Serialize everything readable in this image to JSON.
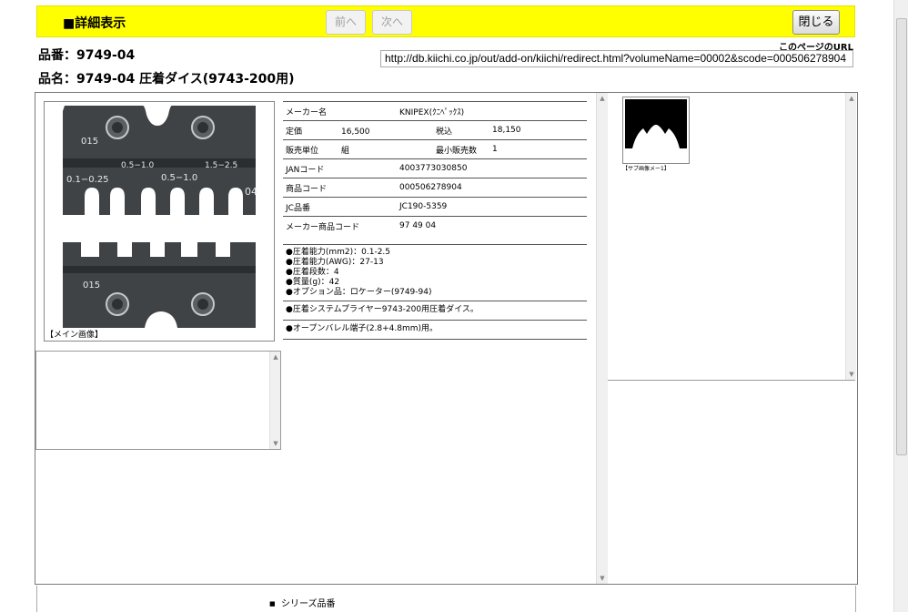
{
  "header": {
    "title": "■詳細表示",
    "prev_label": "前へ",
    "next_label": "次へ",
    "close_label": "閉じる"
  },
  "page_url": {
    "label": "このページのURL",
    "value": "http://db.kiichi.co.jp/out/add-on/kiichi/redirect.html?volumeName=00002&scode=000506278904"
  },
  "product": {
    "number_line": "品番：9749-04",
    "name_line": "品名：9749-04 圧着ダイス(9743-200用)"
  },
  "main_image": {
    "caption": "【メイン画像】",
    "die_labels": {
      "top_code": "015",
      "bottom_code": "015",
      "size_a": "0.5−1.0",
      "size_b": "1.5−2.5",
      "size_c": "0.1−0.25",
      "size_d": "0.5−1.0",
      "part_no": "04"
    }
  },
  "info": {
    "maker_label": "メーカー名",
    "maker_value": "KNIPEX(ｸﾆﾍﾟｯｸｽ)",
    "price_label": "定価",
    "price_value": "16,500",
    "tax_label": "税込",
    "tax_value": "18,150",
    "unit_label": "販売単位",
    "unit_value": "組",
    "min_label": "最小販売数",
    "min_value": "1",
    "jan_label": "JANコード",
    "jan_value": "4003773030850",
    "code_label": "商品コード",
    "code_value": "000506278904",
    "jc_label": "JC品番",
    "jc_value": "JC190-5359",
    "maker_code_label": "メーカー商品コード",
    "maker_code_value": "97 49 04"
  },
  "specs": [
    "●圧着能力(mm2)：0.1-2.5",
    "●圧着能力(AWG)：27-13",
    "●圧着段数：4",
    "●質量(g)：42",
    "●オプション品：ロケーター(9749-94)"
  ],
  "descriptions": [
    "●圧着システムプライヤー9743-200用圧着ダイス。",
    "●オープンバレル端子(2.8+4.8mm)用。"
  ],
  "sub_image": {
    "caption": "【サブ画像メー1】"
  },
  "series": {
    "item_label": "シリーズ品番"
  }
}
